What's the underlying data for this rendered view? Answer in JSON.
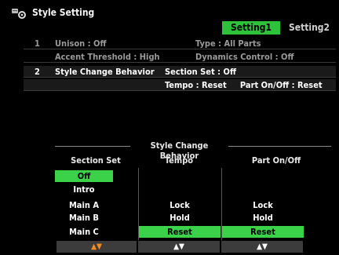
{
  "window": {
    "title": "Style Setting"
  },
  "tabs": [
    {
      "label": "Setting1",
      "active": true
    },
    {
      "label": "Setting2",
      "active": false
    }
  ],
  "settings_list": [
    {
      "num": "1",
      "left": "Unison : Off",
      "right": "Type : All Parts",
      "dim": true
    },
    {
      "num": "",
      "left": "Accent Threshold : High",
      "right": "Dynamics Control : Off",
      "dim": true
    },
    {
      "num": "2",
      "left": "Style Change Behavior",
      "right": "Section Set : Off",
      "dim": false
    },
    {
      "num": "",
      "left": "",
      "right": "Tempo : Reset     Part On/Off : Reset",
      "dim": false
    }
  ],
  "panel": {
    "title": "Style Change Behavior",
    "columns": [
      {
        "header": "Section Set",
        "items": [
          "Off",
          "Intro",
          "Main A",
          "Main B",
          "Main C"
        ],
        "selected": "Off",
        "arrows": "▲▼"
      },
      {
        "header": "Tempo",
        "items": [
          "",
          "",
          "Lock",
          "Hold",
          "Reset"
        ],
        "selected": "Reset",
        "arrows": "▲▼"
      },
      {
        "header": "Part On/Off",
        "items": [
          "",
          "",
          "Lock",
          "Hold",
          "Reset"
        ],
        "selected": "Reset",
        "arrows": "▲▼"
      }
    ]
  },
  "colors": {
    "accent_green": "#3bd24a",
    "arrow_orange": "#ff8a1c"
  }
}
